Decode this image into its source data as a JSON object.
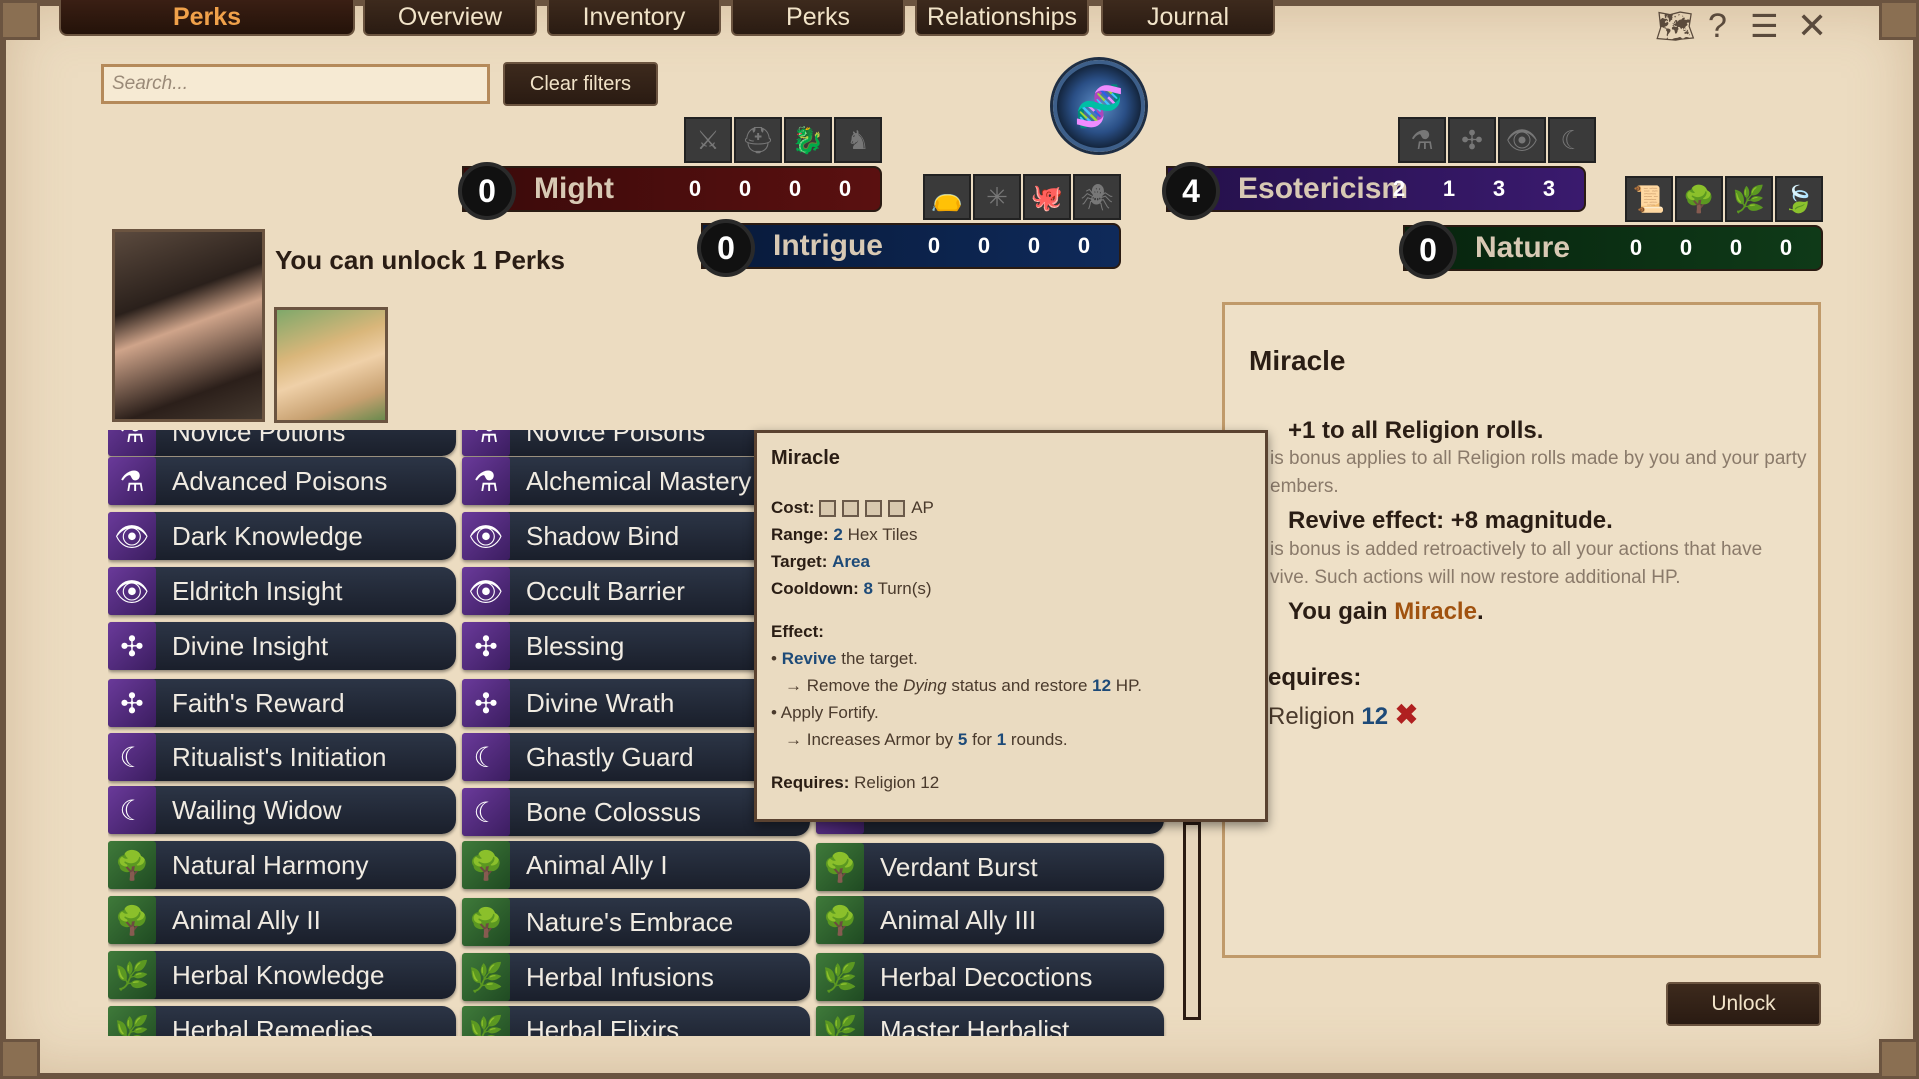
{
  "tabs": {
    "active": "Perks",
    "items": [
      "Overview",
      "Inventory",
      "Perks",
      "Relationships",
      "Journal"
    ]
  },
  "search": {
    "placeholder": "Search..."
  },
  "clear_filters_label": "Clear filters",
  "stats": {
    "might": {
      "level": "0",
      "name": "Might",
      "values": [
        "0",
        "0",
        "0",
        "0"
      ],
      "color": "#5a1010"
    },
    "intrigue": {
      "level": "0",
      "name": "Intrigue",
      "values": [
        "0",
        "0",
        "0",
        "0"
      ],
      "color": "#0f2a5a"
    },
    "esotericism": {
      "level": "4",
      "name": "Esotericism",
      "values": [
        "2",
        "1",
        "3",
        "3"
      ],
      "color": "#3a1a6e"
    },
    "nature": {
      "level": "0",
      "name": "Nature",
      "values": [
        "0",
        "0",
        "0",
        "0"
      ],
      "color": "#0f3a18"
    }
  },
  "unlock_text": "You can unlock 1 Perks",
  "perk_columns": [
    [
      "Novice Potions",
      "Advanced Poisons",
      "Dark Knowledge",
      "Eldritch Insight",
      "Divine Insight",
      "Faith's Reward",
      "Ritualist's Initiation",
      "Wailing Widow",
      "Natural Harmony",
      "Animal Ally II",
      "Herbal Knowledge",
      "Herbal Remedies"
    ],
    [
      "Novice Poisons",
      "Alchemical Mastery",
      "Shadow Bind",
      "Occult Barrier",
      "Blessing",
      "Divine Wrath",
      "Ghastly Guard",
      "Bone Colossus",
      "Animal Ally I",
      "Nature's Embrace",
      "Herbal Infusions",
      "Herbal Elixirs"
    ],
    [
      "Verdant Burst",
      "Animal Ally III",
      "Herbal Decoctions",
      "Master Herbalist"
    ]
  ],
  "tooltip": {
    "title": "Miracle",
    "cost_label": "Cost:",
    "cost_unit": "AP",
    "range_label": "Range:",
    "range_value": "2",
    "range_unit": "Hex Tiles",
    "target_label": "Target:",
    "target_value": "Area",
    "cooldown_label": "Cooldown:",
    "cooldown_value": "8",
    "cooldown_unit": "Turn(s)",
    "effect_label": "Effect:",
    "revive_word": "Revive",
    "revive_rest": "the target.",
    "remove_a": "→ Remove the",
    "remove_dying": "Dying",
    "remove_b": "status and restore",
    "remove_hp": "12",
    "remove_c": "HP.",
    "apply": "• Apply Fortify.",
    "armor_a": "→ Increases Armor by",
    "armor_val": "5",
    "armor_b": "for",
    "armor_rounds": "1",
    "armor_c": "rounds.",
    "requires_label": "Requires:",
    "requires_value": "Religion 12"
  },
  "panel": {
    "title": "Miracle",
    "bonus1": "+1 to all Religion rolls.",
    "bonus1_desc": "is bonus applies to all Religion rolls made by you and your party",
    "bonus1_desc2": "embers.",
    "bonus2": "Revive effect: +8 magnitude.",
    "bonus2_desc": "is bonus is added retroactively to all your actions that have",
    "bonus2_desc2": "vive. Such actions will now restore additional HP.",
    "gain_a": "You gain",
    "gain_b": "Miracle",
    "gain_c": ".",
    "requires": "equires:",
    "req_skill": "Religion",
    "req_value": "12"
  },
  "unlock_button": "Unlock"
}
